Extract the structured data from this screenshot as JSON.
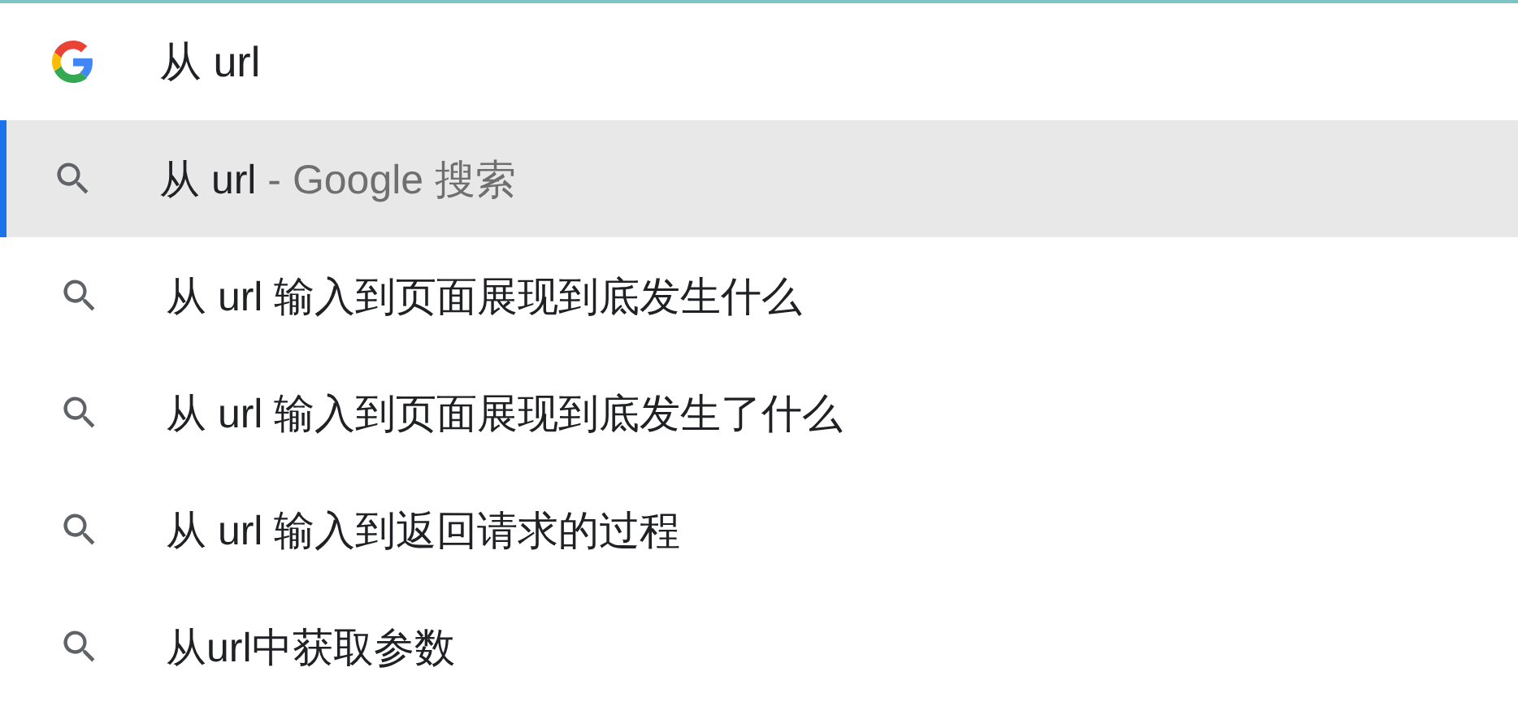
{
  "search": {
    "value": "从 url"
  },
  "suggestions": [
    {
      "text": "从 url",
      "suffix": " - Google 搜索",
      "selected": true
    },
    {
      "text": "从 url 输入到页面展现到底发生什么",
      "selected": false
    },
    {
      "text": "从 url 输入到页面展现到底发生了什么",
      "selected": false
    },
    {
      "text": "从 url 输入到返回请求的过程",
      "selected": false
    },
    {
      "text": "从url中获取参数",
      "selected": false
    }
  ]
}
